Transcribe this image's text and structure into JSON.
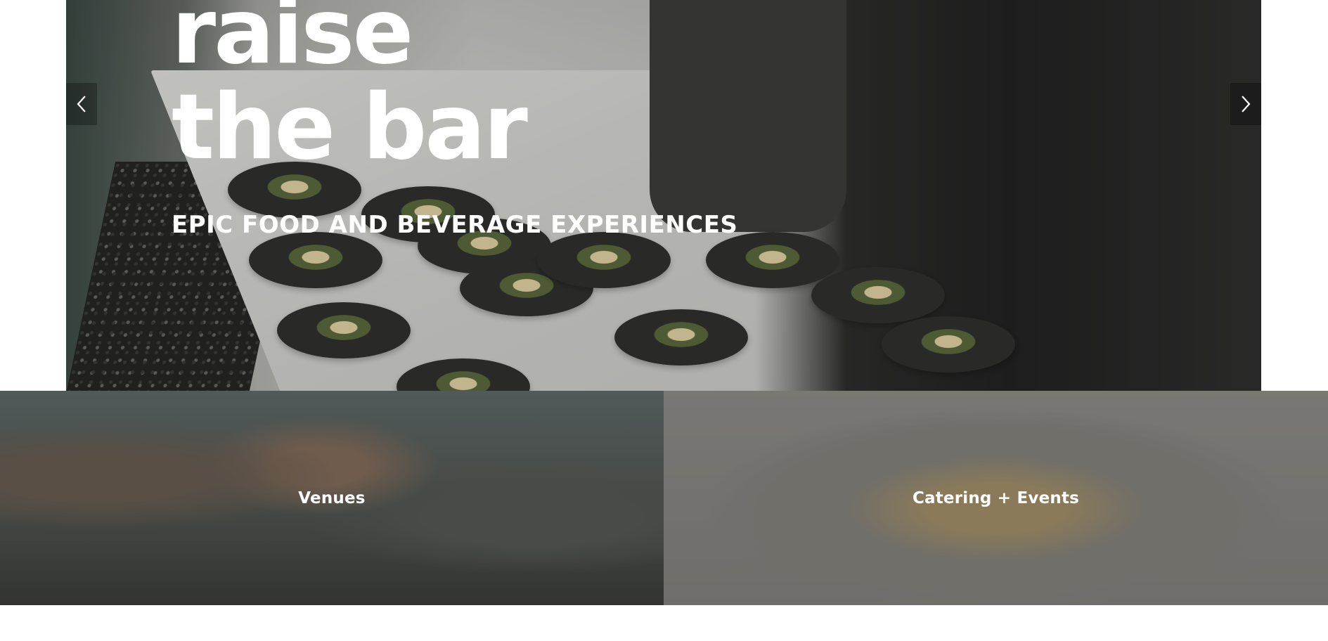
{
  "hero": {
    "headline_line1": "raise",
    "headline_line2": "the bar",
    "subheadline": "EPIC FOOD AND BEVERAGE EXPERIENCES",
    "prev_icon": "chevron-left-icon",
    "next_icon": "chevron-right-icon"
  },
  "tiles": [
    {
      "label": "Venues"
    },
    {
      "label": "Catering + Events"
    }
  ],
  "colors": {
    "text": "#ffffff",
    "arrow_bg": "rgba(0,0,0,0.28)"
  }
}
